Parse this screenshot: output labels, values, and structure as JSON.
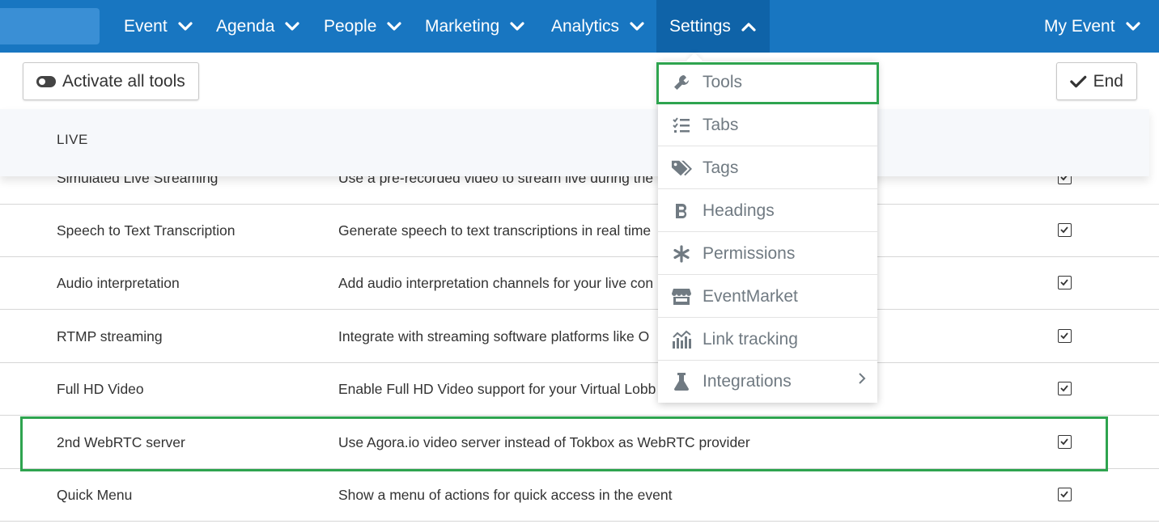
{
  "nav": {
    "items": [
      {
        "label": "Event"
      },
      {
        "label": "Agenda"
      },
      {
        "label": "People"
      },
      {
        "label": "Marketing"
      },
      {
        "label": "Analytics"
      },
      {
        "label": "Settings"
      }
    ],
    "right_label": "My Event"
  },
  "toolbar": {
    "activate_label": "Activate all tools",
    "end_label": "End"
  },
  "section": {
    "title": "LIVE"
  },
  "rows": [
    {
      "name": "Simulated Live Streaming",
      "desc": "Use a pre-recorded video to stream live during the",
      "checked": true
    },
    {
      "name": "Speech to Text Transcription",
      "desc": "Generate speech to text transcriptions in real time",
      "checked": true
    },
    {
      "name": "Audio interpretation",
      "desc": "Add audio interpretation channels for your live con",
      "checked": true
    },
    {
      "name": "RTMP streaming",
      "desc": "Integrate with streaming software platforms like O",
      "checked": true
    },
    {
      "name": "Full HD Video",
      "desc": "Enable Full HD Video support for your Virtual Lobb",
      "checked": true
    },
    {
      "name": "2nd WebRTC server",
      "desc": "Use Agora.io video server instead of Tokbox as WebRTC provider",
      "checked": true
    },
    {
      "name": "Quick Menu",
      "desc": "Show a menu of actions for quick access in the event",
      "checked": true
    }
  ],
  "settings_menu": {
    "items": [
      {
        "label": "Tools",
        "icon": "wrench-icon"
      },
      {
        "label": "Tabs",
        "icon": "list-check-icon"
      },
      {
        "label": "Tags",
        "icon": "tags-icon"
      },
      {
        "label": "Headings",
        "icon": "bold-b-icon"
      },
      {
        "label": "Permissions",
        "icon": "asterisk-icon"
      },
      {
        "label": "EventMarket",
        "icon": "store-icon"
      },
      {
        "label": "Link tracking",
        "icon": "chart-icon"
      },
      {
        "label": "Integrations",
        "icon": "flask-icon"
      }
    ]
  },
  "colors": {
    "nav_bg": "#1876c1",
    "nav_active": "#0f63a8",
    "highlight": "#2ea44f",
    "menu_text": "#707a82"
  }
}
